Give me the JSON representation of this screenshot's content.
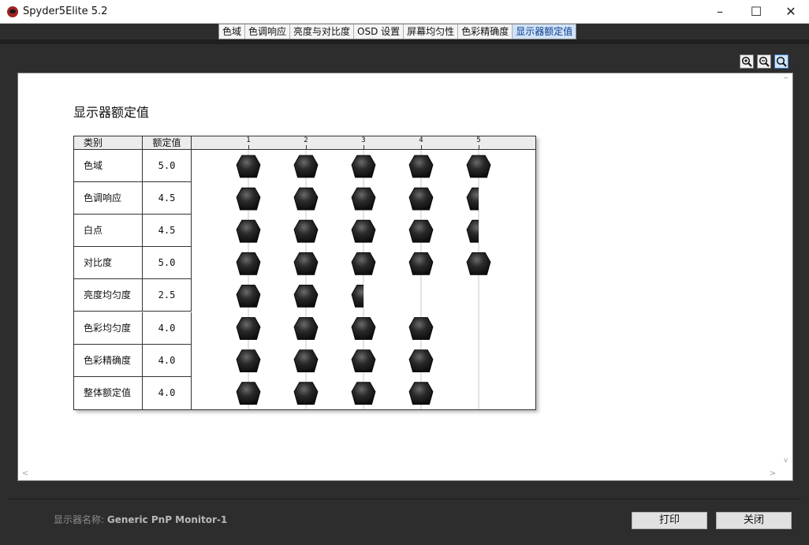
{
  "window": {
    "title": "Spyder5Elite 5.2",
    "minimize": "–",
    "maximize": "☐",
    "close": "✕"
  },
  "tabs": [
    {
      "label": "色域",
      "active": false
    },
    {
      "label": "色调响应",
      "active": false
    },
    {
      "label": "亮度与对比度",
      "active": false
    },
    {
      "label": "OSD 设置",
      "active": false
    },
    {
      "label": "屏幕均匀性",
      "active": false
    },
    {
      "label": "色彩精确度",
      "active": false
    },
    {
      "label": "显示器额定值",
      "active": true
    }
  ],
  "zoom": {
    "icons": [
      "zoom-in-icon",
      "zoom-out-icon",
      "zoom-fit-icon"
    ],
    "active": "zoom-fit-icon"
  },
  "report": {
    "title": "显示器额定值",
    "header_category": "类别",
    "header_value": "额定值"
  },
  "chart_data": {
    "type": "table",
    "scale_ticks": [
      "1",
      "2",
      "3",
      "4",
      "5"
    ],
    "scale_max": 5,
    "rows": [
      {
        "category": "色域",
        "value": "5.0",
        "rating": 5.0
      },
      {
        "category": "色调响应",
        "value": "4.5",
        "rating": 4.5
      },
      {
        "category": "白点",
        "value": "4.5",
        "rating": 4.5
      },
      {
        "category": "对比度",
        "value": "5.0",
        "rating": 5.0
      },
      {
        "category": "亮度均匀度",
        "value": "2.5",
        "rating": 2.5
      },
      {
        "category": "色彩均匀度",
        "value": "4.0",
        "rating": 4.0
      },
      {
        "category": "色彩精确度",
        "value": "4.0",
        "rating": 4.0
      },
      {
        "category": "整体额定值",
        "value": "4.0",
        "rating": 4.0
      }
    ],
    "icon": "spyder-icon"
  },
  "footer": {
    "monitor_label": "显示器名称: ",
    "monitor_name": "Generic PnP Monitor-1",
    "print_label": "打印",
    "close_label": "关闭"
  },
  "colors": {
    "accent": "#cfe3f8",
    "background": "#2d2d2d",
    "icon": "#1a1a1a"
  }
}
